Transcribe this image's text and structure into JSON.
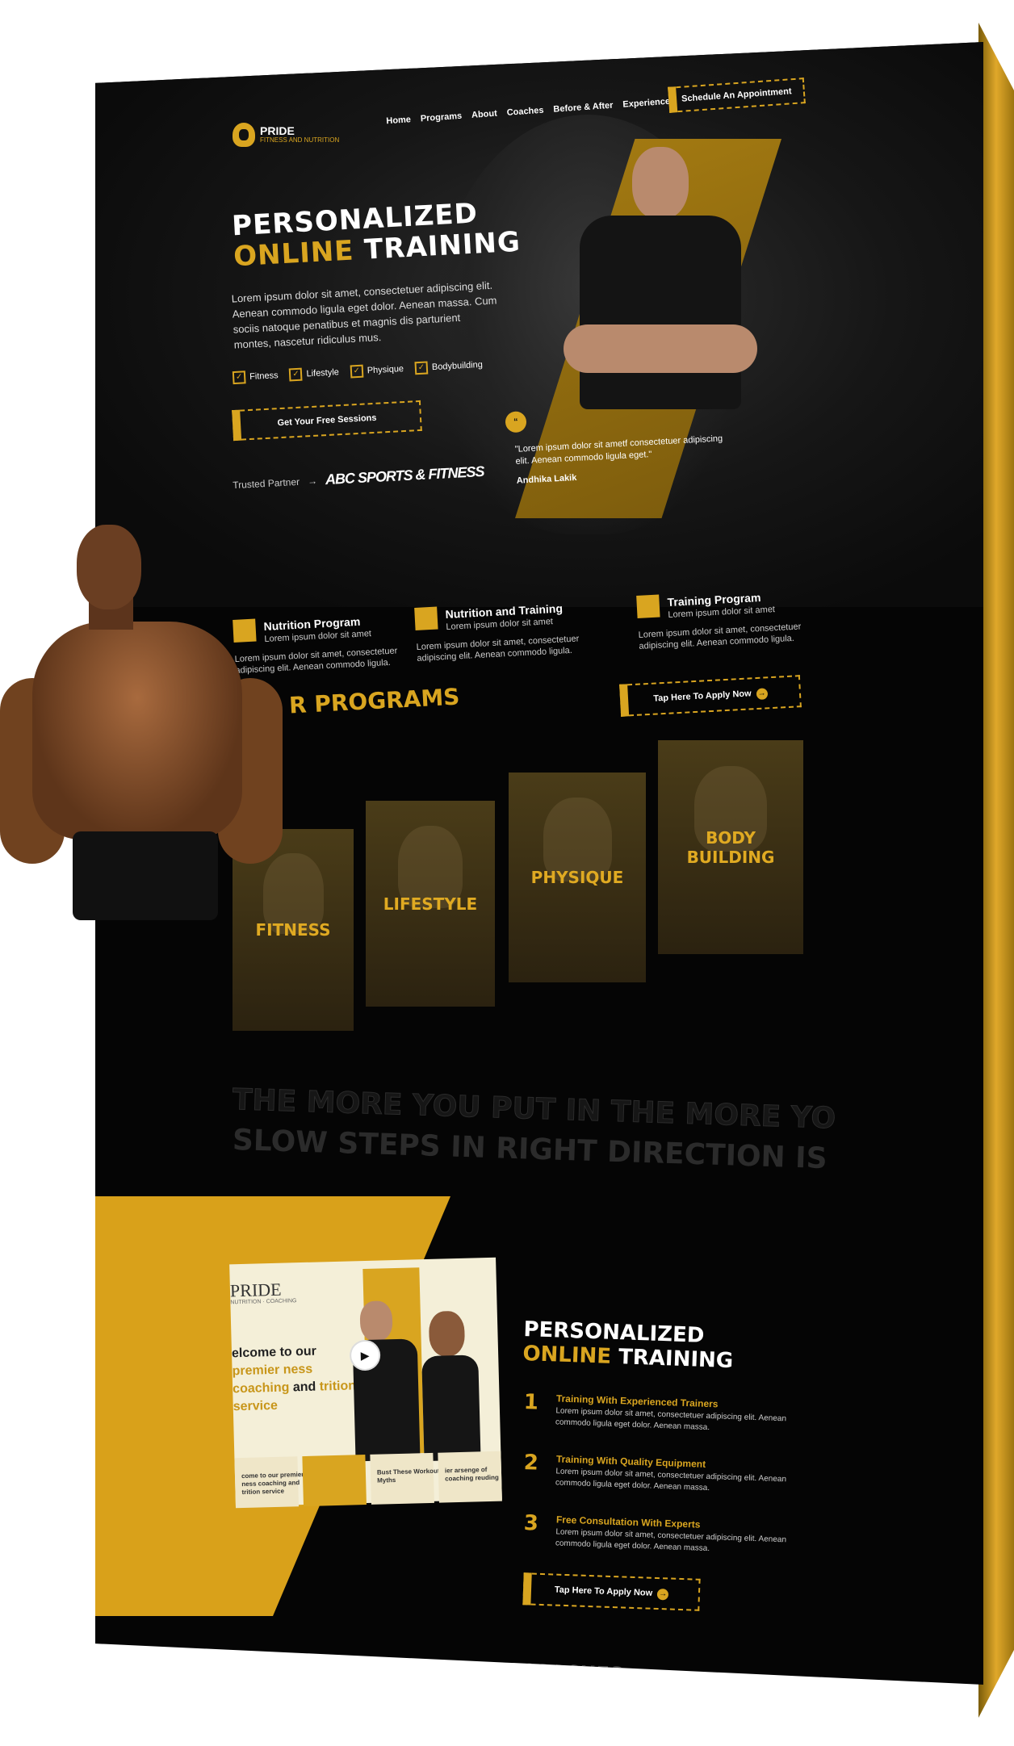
{
  "nav": {
    "logo_title": "PRIDE",
    "logo_sub": "FITNESS AND NUTRITION",
    "menu": [
      "Home",
      "Programs",
      "About",
      "Coaches",
      "Before & After",
      "Experience"
    ],
    "cta": "Schedule An Appointment"
  },
  "hero": {
    "title_line1": "PERSONALIZED",
    "title_gold": "ONLINE",
    "title_rest": "TRAINING",
    "lead": "Lorem ipsum dolor sit amet, consectetuer adipiscing elit. Aenean commodo ligula eget dolor. Aenean massa. Cum sociis natoque penatibus et magnis dis parturient montes, nascetur ridiculus mus.",
    "checks": [
      "Fitness",
      "Lifestyle",
      "Physique",
      "Bodybuilding"
    ],
    "button": "Get Your Free Sessions",
    "partner_label": "Trusted Partner",
    "partner_name": "ABC SPORTS & FITNESS",
    "quote": "\"Lorem ipsum dolor sit ametf consectetuer adipiscing elit. Aenean commodo ligula eget.\"",
    "quote_author": "Andhika Lakik"
  },
  "features": [
    {
      "title": "Nutrition Program",
      "sub": "Lorem ipsum dolor sit amet",
      "desc": "Lorem ipsum dolor sit amet, consectetuer adipiscing elit. Aenean commodo ligula."
    },
    {
      "title": "Nutrition and Training",
      "sub": "Lorem ipsum dolor sit amet",
      "desc": "Lorem ipsum dolor sit amet, consectetuer adipiscing elit. Aenean commodo ligula."
    },
    {
      "title": "Training Program",
      "sub": "Lorem ipsum dolor sit amet",
      "desc": "Lorem ipsum dolor sit amet, consectetuer adipiscing elit. Aenean commodo ligula."
    }
  ],
  "programs": {
    "title": "R PROGRAMS",
    "apply": "Tap Here To Apply Now",
    "cards": [
      "FITNESS",
      "LIFESTYLE",
      "PHYSIQUE",
      "BODY BUILDING"
    ]
  },
  "slogans": [
    "THE MORE YOU PUT IN THE MORE YO",
    "SLOW STEPS IN RIGHT DIRECTION IS"
  ],
  "training": {
    "video_logo": "PRIDE",
    "video_logo_sub": "NUTRITION · COACHING",
    "video_text_1": "elcome to our",
    "video_text_gold1": "premier",
    "video_text_gold2": "ness coaching",
    "video_text_2": "and",
    "video_text_gold3": "trition service",
    "thumb_texts": [
      "come to our premier ness coaching and trition service",
      "",
      "Bust These Workout Myths",
      "ier arsenge of coaching reuding"
    ],
    "title_line1": "PERSONALIZED",
    "title_gold": "ONLINE",
    "title_rest": "TRAINING",
    "steps": [
      {
        "num": "1",
        "title": "Training With Experienced Trainers",
        "desc": "Lorem ipsum dolor sit amet, consectetuer adipiscing elit. Aenean commodo ligula eget dolor. Aenean massa."
      },
      {
        "num": "2",
        "title": "Training With Quality Equipment",
        "desc": "Lorem ipsum dolor sit amet, consectetuer adipiscing elit. Aenean commodo ligula eget dolor. Aenean massa."
      },
      {
        "num": "3",
        "title": "Free Consultation With Experts",
        "desc": "Lorem ipsum dolor sit amet, consectetuer adipiscing elit. Aenean commodo ligula eget dolor. Aenean massa."
      }
    ],
    "apply": "Tap Here To Apply Now"
  },
  "coaches_heading": "OUR COACHES",
  "colors": {
    "accent": "#d9a520",
    "background": "#050505"
  }
}
